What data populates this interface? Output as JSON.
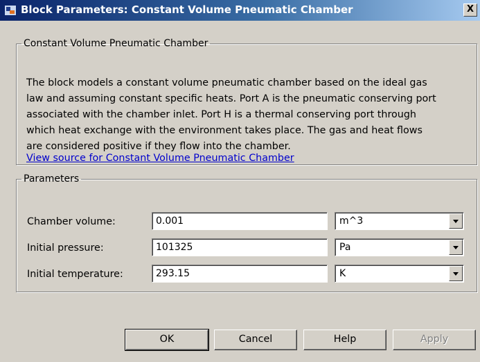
{
  "window": {
    "title": "Block Parameters: Constant Volume Pneumatic Chamber",
    "close_label": "X"
  },
  "description_group": {
    "legend": "Constant Volume Pneumatic Chamber",
    "lines": [
      "The block models a constant volume pneumatic chamber based on the ideal gas",
      "law and assuming constant specific heats. Port A is the pneumatic conserving port",
      "associated with the chamber inlet. Port H is a thermal conserving port through",
      "which heat exchange with the environment takes place. The gas and heat flows",
      "are considered positive if they flow into the chamber."
    ],
    "source_link": "View source for Constant Volume Pneumatic Chamber"
  },
  "parameters_group": {
    "legend": "Parameters",
    "rows": [
      {
        "label": "Chamber volume:",
        "value": "0.001",
        "unit": "m^3"
      },
      {
        "label": "Initial pressure:",
        "value": "101325",
        "unit": "Pa"
      },
      {
        "label": "Initial temperature:",
        "value": "293.15",
        "unit": "K"
      }
    ]
  },
  "buttons": {
    "ok": "OK",
    "cancel": "Cancel",
    "help": "Help",
    "apply": "Apply"
  }
}
